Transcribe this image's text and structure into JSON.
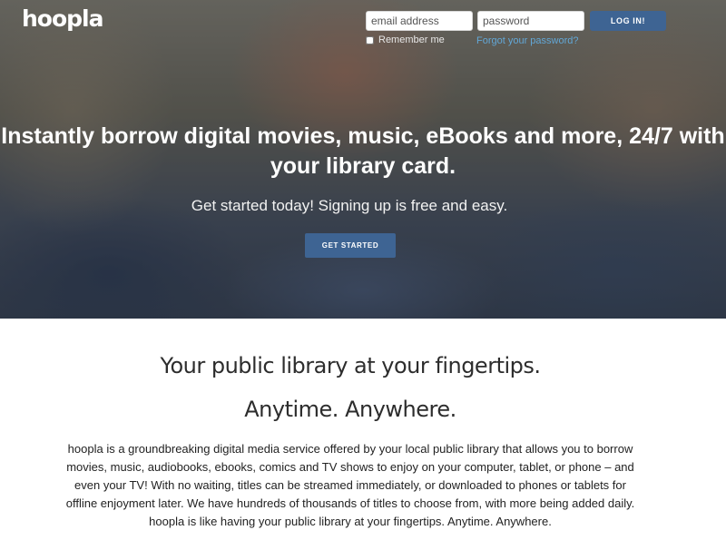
{
  "header": {
    "logo_text": "hoopla",
    "login": {
      "email_placeholder": "email address",
      "password_placeholder": "password",
      "login_button": "LOG IN!",
      "remember_me": "Remember me",
      "forgot_password": "Forgot your password?"
    }
  },
  "hero": {
    "headline": "Instantly borrow digital movies, music, eBooks and more, 24/7 with your library card.",
    "subheadline": "Get started today! Signing up is free and easy.",
    "cta_button": "GET STARTED"
  },
  "main": {
    "tagline": "Your public library at your fingertips.",
    "tagline_2": "Anytime. Anywhere.",
    "description": "hoopla is a groundbreaking digital media service offered by your local public library that allows you to borrow movies, music, audiobooks, ebooks, comics and TV shows to enjoy on your computer, tablet, or phone – and even your TV! With no waiting, titles can be streamed immediately, or downloaded to phones or tablets for offline enjoyment later. We have hundreds of thousands of titles to choose from, with more being added daily. hoopla is like having your public library at your fingertips. Anytime. Anywhere."
  },
  "colors": {
    "button_blue": "#3e6493",
    "link_blue": "#62a7d6",
    "text_dark": "#2d2d2d"
  }
}
